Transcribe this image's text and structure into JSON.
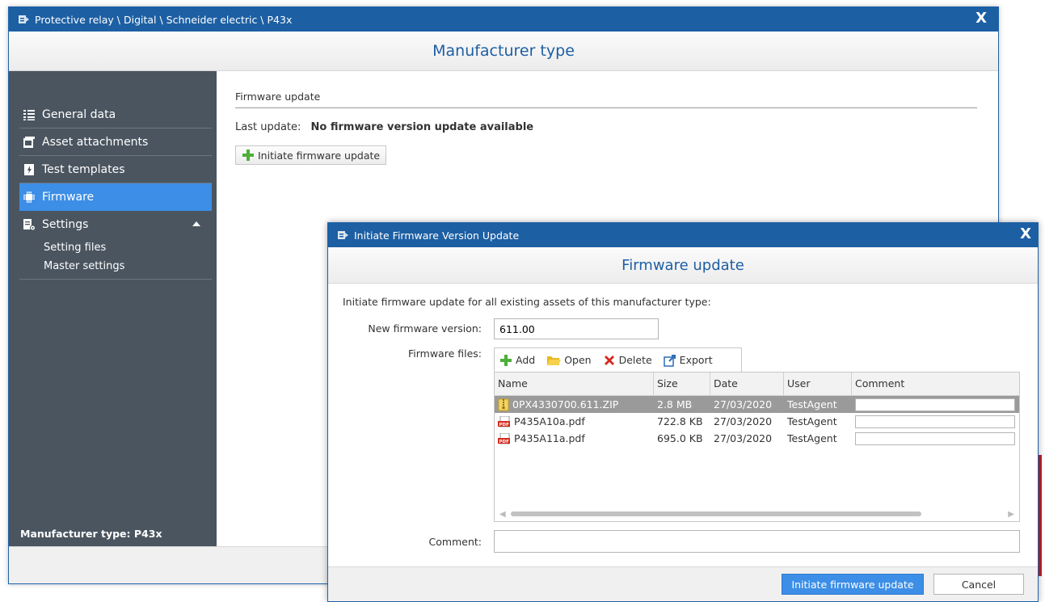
{
  "main_window": {
    "title": "Protective relay \\ Digital \\ Schneider electric \\ P43x",
    "close_label": "X",
    "header": "Manufacturer type",
    "sidebar": {
      "items": [
        {
          "label": "General data",
          "icon": "list-icon"
        },
        {
          "label": "Asset attachments",
          "icon": "attachment-icon"
        },
        {
          "label": "Test templates",
          "icon": "template-icon"
        },
        {
          "label": "Firmware",
          "icon": "chip-icon",
          "active": true
        },
        {
          "label": "Settings",
          "icon": "settings-icon",
          "expanded": true
        }
      ],
      "sub_items": [
        "Setting files",
        "Master settings"
      ],
      "footer": "Manufacturer type:  P43x"
    },
    "content": {
      "section_title": "Firmware update",
      "last_update_label": "Last update:",
      "last_update_value": "No firmware version update available",
      "init_button": "Initiate firmware update"
    }
  },
  "dialog": {
    "title": "Initiate Firmware Version Update",
    "close_label": "X",
    "header": "Firmware update",
    "intro": "Initiate firmware update for all existing assets of this manufacturer type:",
    "new_version_label": "New firmware version:",
    "new_version_value": "611.00",
    "files_label": "Firmware files:",
    "toolbar": {
      "add": "Add",
      "open": "Open",
      "delete": "Delete",
      "export": "Export"
    },
    "columns": [
      "Name",
      "Size",
      "Date",
      "User",
      "Comment"
    ],
    "rows": [
      {
        "name": "0PX4330700.611.ZIP",
        "type": "zip",
        "size": "2.8 MB",
        "date": "27/03/2020",
        "user": "TestAgent",
        "selected": true
      },
      {
        "name": "P435A10a.pdf",
        "type": "pdf",
        "size": "722.8 KB",
        "date": "27/03/2020",
        "user": "TestAgent",
        "selected": false
      },
      {
        "name": "P435A11a.pdf",
        "type": "pdf",
        "size": "695.0 KB",
        "date": "27/03/2020",
        "user": "TestAgent",
        "selected": false
      }
    ],
    "comment_label": "Comment:",
    "primary_button": "Initiate firmware update",
    "cancel_button": "Cancel"
  },
  "colors": {
    "titlebar": "#1d5fa3",
    "sidebar": "#4a5560",
    "active": "#3c8ee6",
    "accent_red": "#c0202a"
  }
}
